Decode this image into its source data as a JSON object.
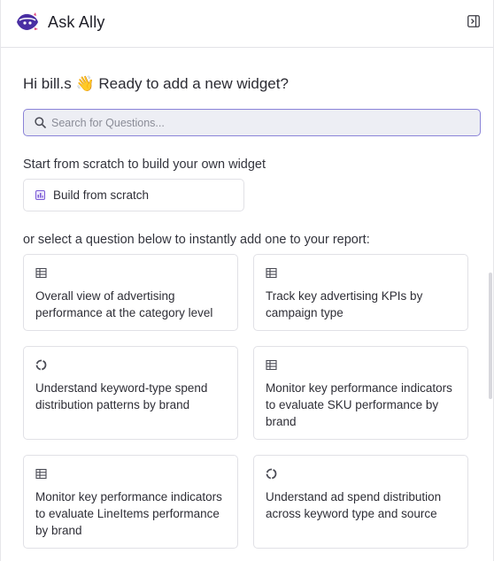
{
  "header": {
    "title": "Ask Ally",
    "logo_icon": "ally-logo-icon",
    "collapse_icon": "panel-collapse-icon"
  },
  "greeting": "Hi bill.s 👋 Ready to add a new widget?",
  "search": {
    "placeholder": "Search for Questions...",
    "value": ""
  },
  "scratch": {
    "label": "Start from scratch to build your own widget",
    "button_label": "Build from scratch",
    "button_icon": "build-icon"
  },
  "questions": {
    "label": "or select a question below to instantly add one to your report:",
    "items": [
      {
        "icon": "table-icon",
        "text": "Overall view of advertising performance at the category level"
      },
      {
        "icon": "table-icon",
        "text": "Track key advertising KPIs by campaign type"
      },
      {
        "icon": "donut-chart-icon",
        "text": "Understand keyword-type spend distribution patterns by brand"
      },
      {
        "icon": "table-icon",
        "text": "Monitor key performance indicators to evaluate SKU performance by brand"
      },
      {
        "icon": "table-icon",
        "text": "Monitor key performance indicators to evaluate LineItems performance by brand"
      },
      {
        "icon": "donut-chart-icon",
        "text": "Understand ad spend distribution across keyword type and source"
      }
    ]
  },
  "colors": {
    "accent": "#6e56cf",
    "search_border": "#8a83d8",
    "search_bg": "#edeef4",
    "card_border": "#e1e1e6"
  }
}
